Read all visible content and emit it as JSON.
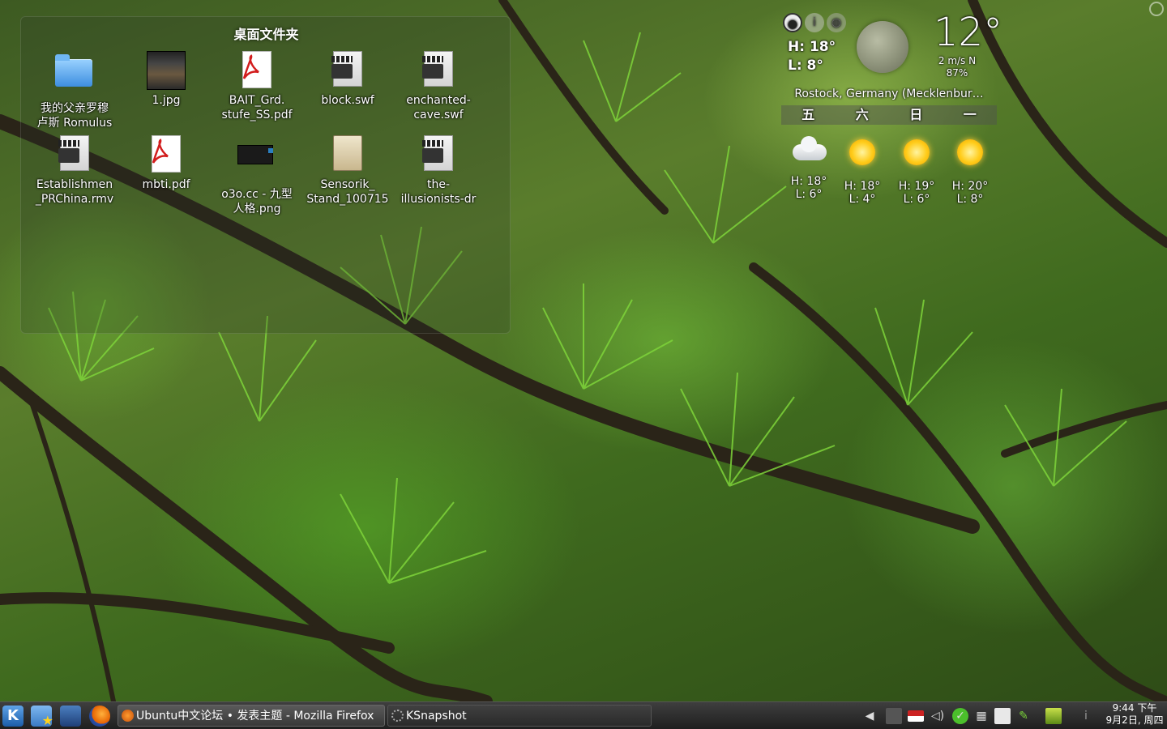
{
  "folder_view": {
    "title": "桌面文件夹",
    "items": [
      {
        "label1": "我的父亲罗穆",
        "label2": "卢斯 Romulus",
        "icon": "folder-icon"
      },
      {
        "label1": "1.jpg",
        "label2": "",
        "icon": "image-file-icon"
      },
      {
        "label1": "BAIT_Grd.",
        "label2": "stufe_SS.pdf",
        "icon": "pdf-file-icon"
      },
      {
        "label1": "block.swf",
        "label2": "",
        "icon": "flash-file-icon"
      },
      {
        "label1": "enchanted-",
        "label2": "cave.swf",
        "icon": "flash-file-icon"
      },
      {
        "label1": "Establishmen",
        "label2": "_PRChina.rmv",
        "icon": "video-file-icon"
      },
      {
        "label1": "mbti.pdf",
        "label2": "",
        "icon": "pdf-file-icon"
      },
      {
        "label1": "o3o.cc - 九型",
        "label2": "人格.png",
        "icon": "png-file-icon"
      },
      {
        "label1": "Sensorik_",
        "label2": "Stand_100715",
        "icon": "package-file-icon"
      },
      {
        "label1": "the-",
        "label2": "illusionists-dr",
        "icon": "flash-file-icon"
      }
    ]
  },
  "weather": {
    "today_high": "H: 18°",
    "today_low": "L: 8°",
    "current_temp": "12°",
    "wind": "2 m/s N",
    "humidity": "87%",
    "location": "Rostock, Germany (Mecklenbur…",
    "days": [
      "五",
      "六",
      "日",
      "一"
    ],
    "forecast": [
      {
        "icon": "cloudy-icon",
        "high": "H: 18°",
        "low": "L: 6°"
      },
      {
        "icon": "sunny-icon",
        "high": "H: 18°",
        "low": "L: 4°"
      },
      {
        "icon": "sunny-icon",
        "high": "H: 19°",
        "low": "L: 6°"
      },
      {
        "icon": "sunny-icon",
        "high": "H: 20°",
        "low": "L: 8°"
      }
    ]
  },
  "taskbar": {
    "tasks": [
      {
        "label": "Ubuntu中文论坛 • 发表主题 - Mozilla Firefox",
        "icon": "firefox-icon"
      },
      {
        "label": "KSnapshot",
        "icon": "ksnapshot-icon"
      }
    ],
    "clock_time": "9:44 下午",
    "clock_date": "9月2日, 周四"
  }
}
